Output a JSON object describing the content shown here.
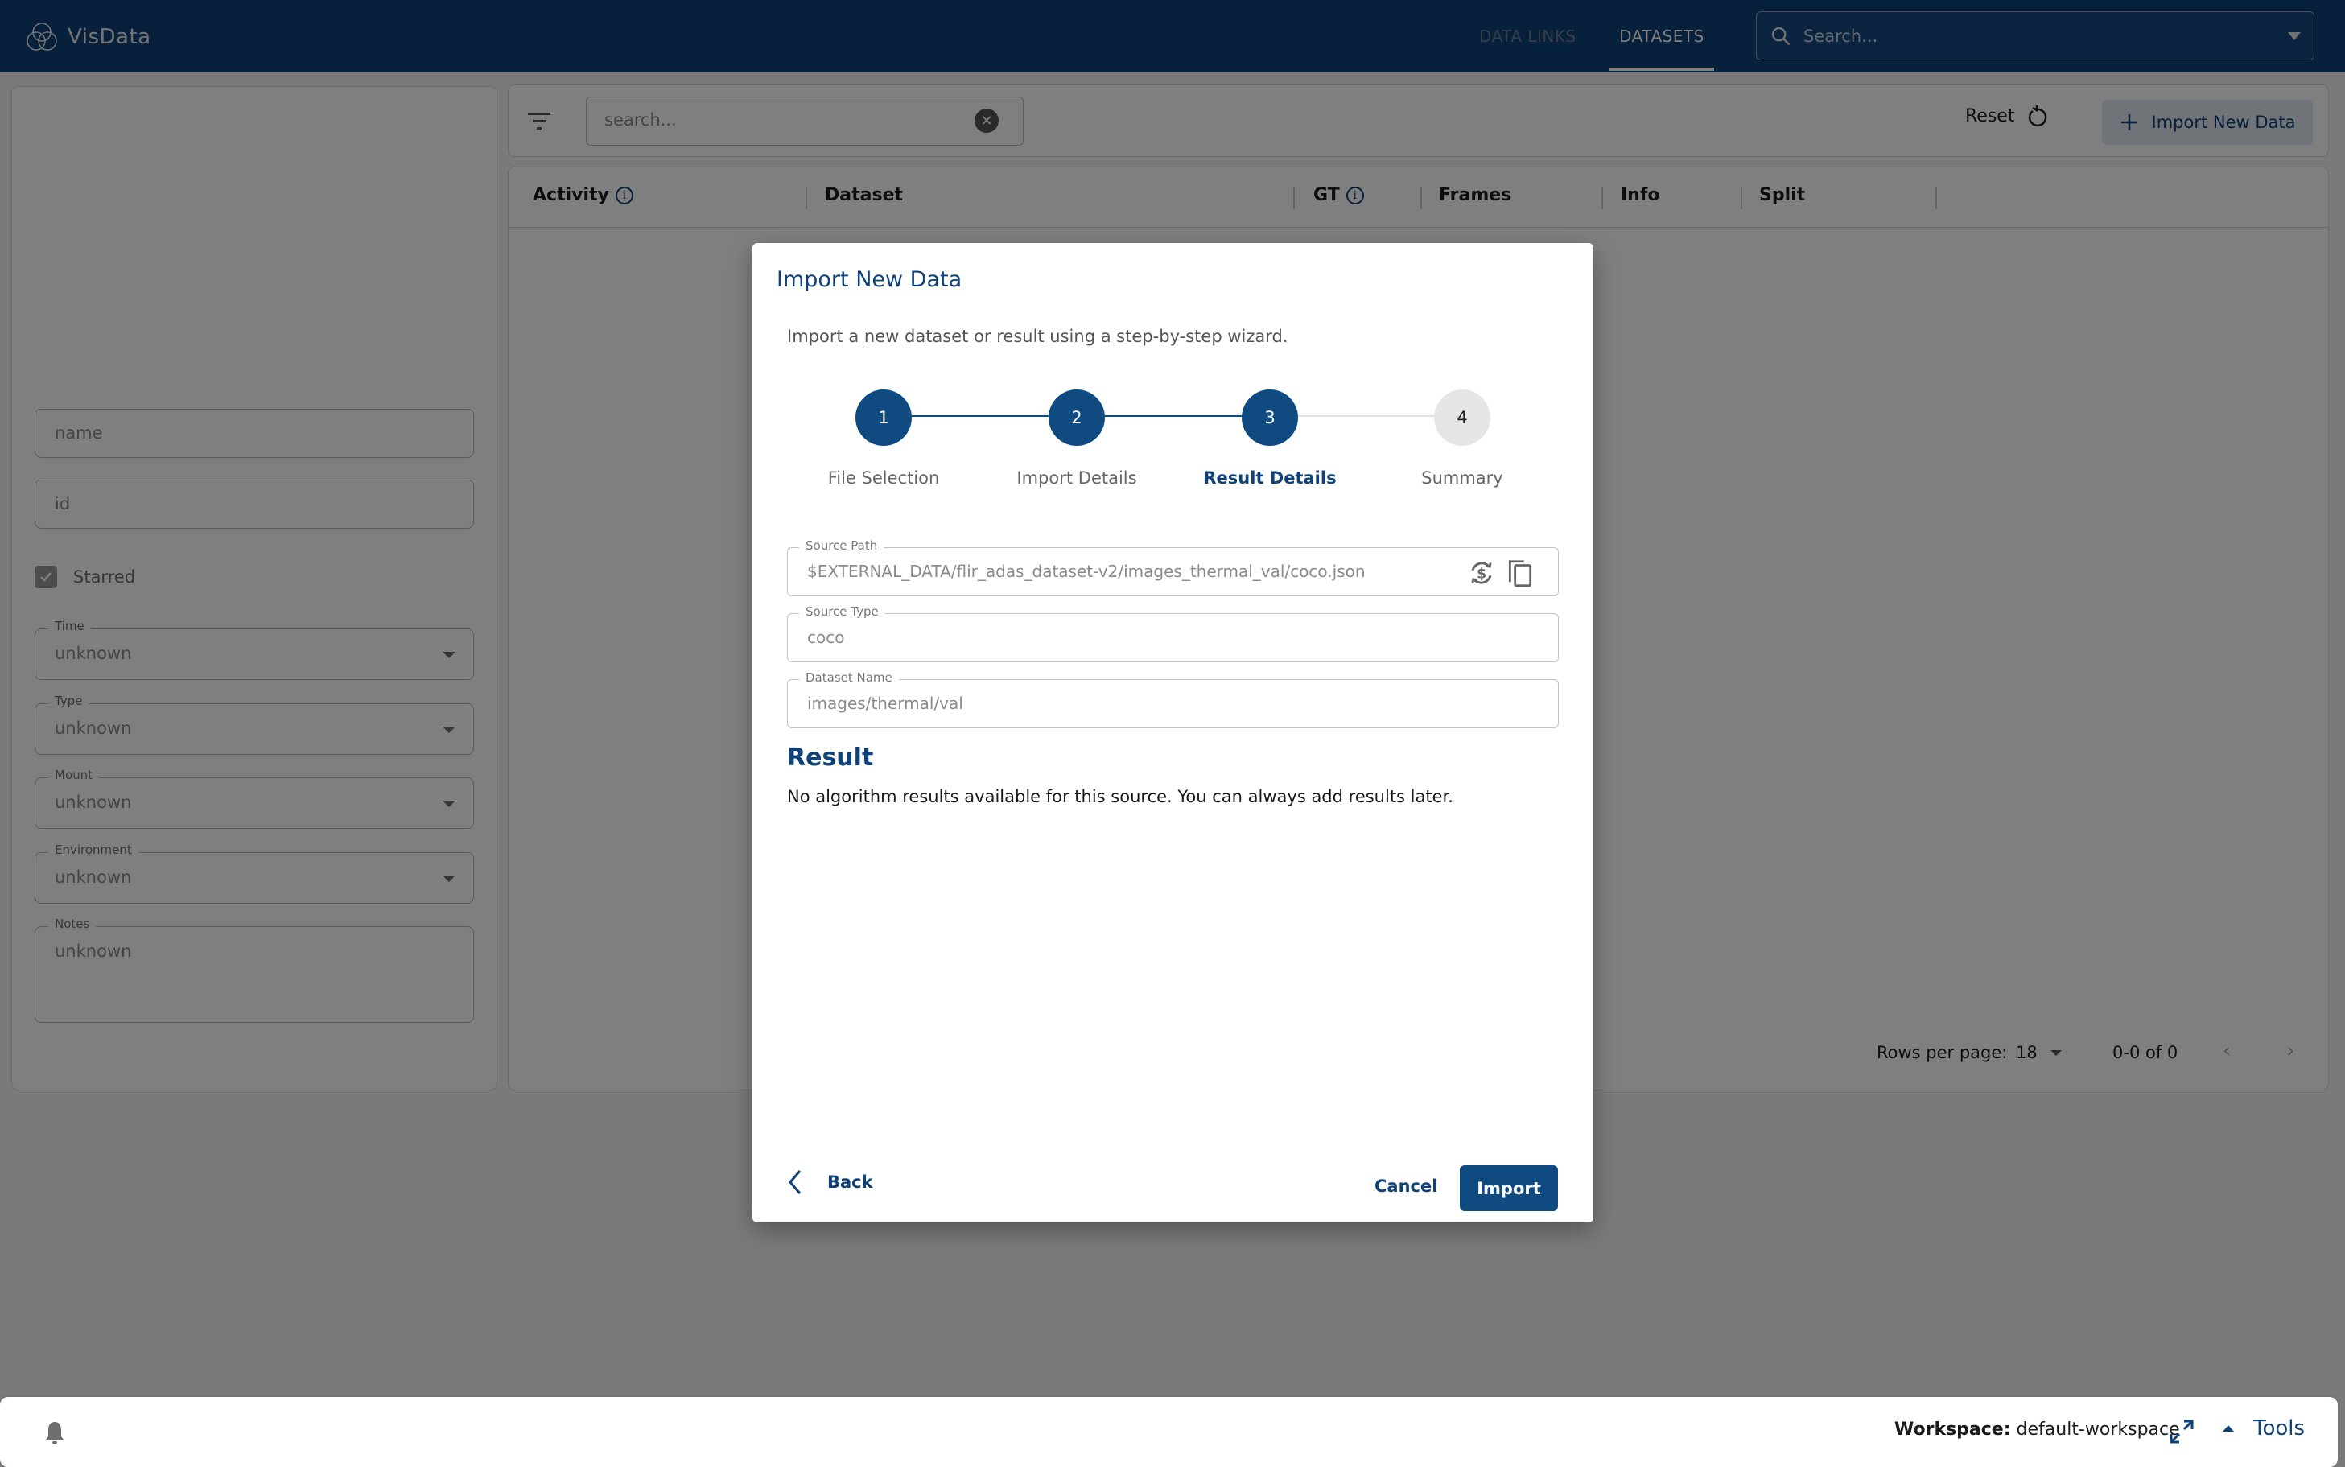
{
  "app": {
    "name": "VisData",
    "nav_tabs": [
      {
        "label": "DATA LINKS",
        "active": false
      },
      {
        "label": "DATASETS",
        "active": true
      }
    ],
    "search_placeholder": "Search..."
  },
  "sidebar": {
    "name_placeholder": "name",
    "id_placeholder": "id",
    "starred_label": "Starred",
    "starred_checked": true,
    "fields": [
      {
        "label": "Time",
        "value": "unknown"
      },
      {
        "label": "Type",
        "value": "unknown"
      },
      {
        "label": "Mount",
        "value": "unknown"
      },
      {
        "label": "Environment",
        "value": "unknown"
      }
    ],
    "notes": {
      "label": "Notes",
      "value": "unknown"
    }
  },
  "toolbar": {
    "search_placeholder": "search...",
    "reset_label": "Reset",
    "import_label": "Import New Data"
  },
  "table": {
    "columns": [
      "Activity",
      "Dataset",
      "GT",
      "Frames",
      "Info",
      "Split"
    ],
    "rows": [],
    "rows_per_page_label": "Rows per page:",
    "rows_per_page": "18",
    "range": "0-0 of 0"
  },
  "modal": {
    "title": "Import New Data",
    "description": "Import a new dataset or result using a step-by-step wizard.",
    "steps": [
      {
        "number": "1",
        "label": "File Selection",
        "state": "done"
      },
      {
        "number": "2",
        "label": "Import Details",
        "state": "done"
      },
      {
        "number": "3",
        "label": "Result Details",
        "state": "active"
      },
      {
        "number": "4",
        "label": "Summary",
        "state": "todo"
      }
    ],
    "fields": {
      "source_path": {
        "label": "Source Path",
        "value": "$EXTERNAL_DATA/flir_adas_dataset-v2/images_thermal_val/coco.json"
      },
      "source_type": {
        "label": "Source Type",
        "value": "coco"
      },
      "dataset_name": {
        "label": "Dataset Name",
        "value": "images/thermal/val"
      }
    },
    "result_title": "Result",
    "result_text": "No algorithm results available for this source. You can always add results later.",
    "back_label": "Back",
    "cancel_label": "Cancel",
    "import_label": "Import"
  },
  "footer": {
    "workspace_label": "Workspace:",
    "workspace_value": "default-workspace",
    "tools_label": "Tools"
  },
  "colors": {
    "brand": "#0f4279",
    "primary": "#0f4a80",
    "step_todo": "#e6e6e6"
  }
}
